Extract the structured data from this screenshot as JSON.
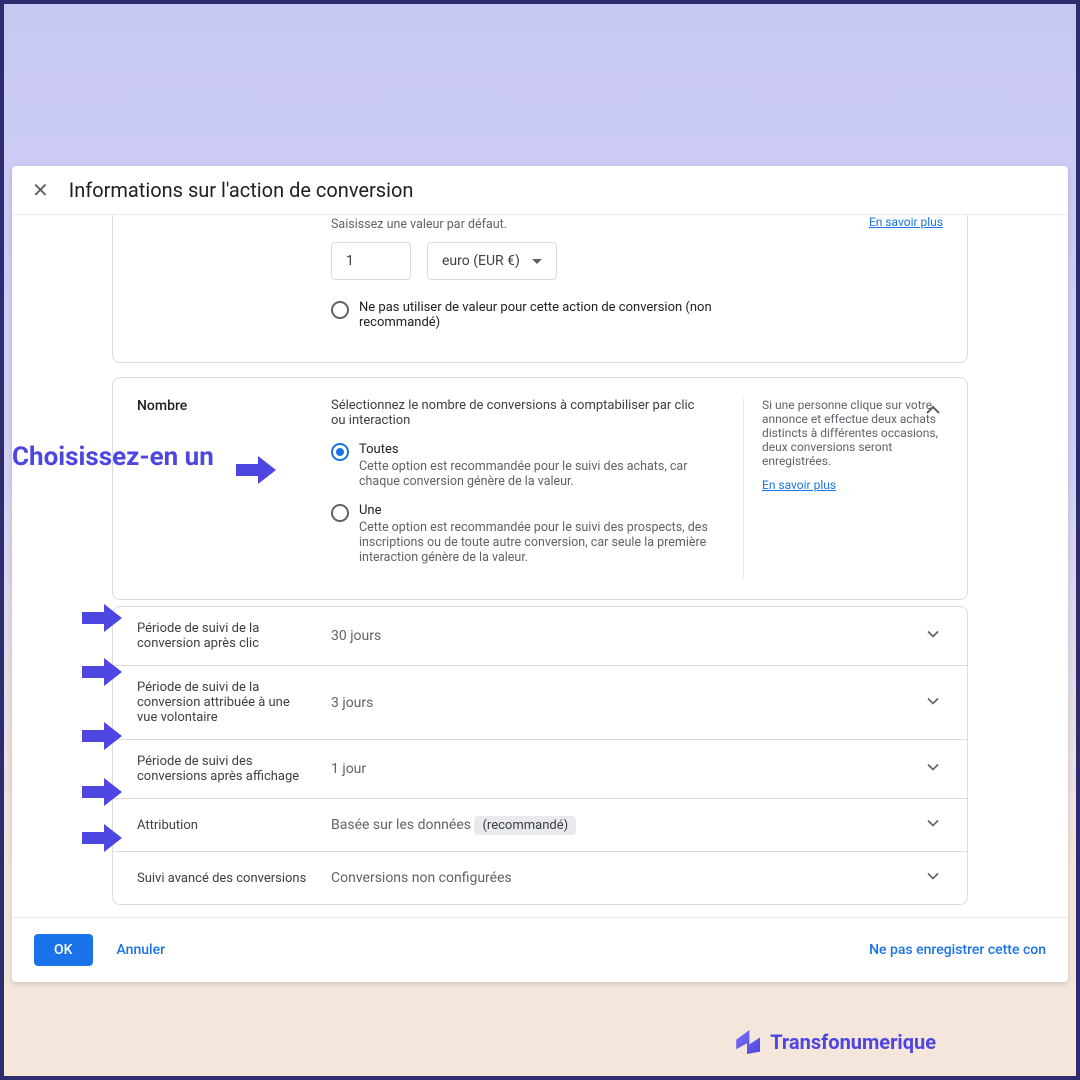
{
  "header": {
    "title": "Informations sur l'action de conversion"
  },
  "value_section": {
    "prompt": "Saisissez une valeur par défaut.",
    "default_value": "1",
    "currency_label": "euro (EUR €)",
    "no_value_label": "Ne pas utiliser de valeur pour cette action de conversion (non recommandé)",
    "learn_more_cut": "En savoir plus"
  },
  "count_section": {
    "title": "Nombre",
    "prompt": "Sélectionnez le nombre de conversions à comptabiliser par clic ou interaction",
    "option_all_label": "Toutes",
    "option_all_desc": "Cette option est recommandée pour le suivi des achats, car chaque conversion génère de la valeur.",
    "option_one_label": "Une",
    "option_one_desc": "Cette option est recommandée pour le suivi des prospects, des inscriptions ou de toute autre conversion, car seule la première interaction génère de la valeur.",
    "help_text": "Si une personne clique sur votre annonce et effectue deux achats distincts à différentes occasions, deux conversions seront enregistrées.",
    "learn_more": "En savoir plus"
  },
  "settings": [
    {
      "label": "Période de suivi de la conversion après clic",
      "value": "30 jours"
    },
    {
      "label": "Période de suivi de la conversion attribuée à une vue volontaire",
      "value": "3 jours"
    },
    {
      "label": "Période de suivi des conversions après affichage",
      "value": "1 jour"
    },
    {
      "label": "Attribution",
      "value": "Basée sur les données",
      "badge": "(recommandé)"
    },
    {
      "label": "Suivi avancé des conversions",
      "value": "Conversions non configurées"
    }
  ],
  "footer": {
    "ok": "OK",
    "cancel": "Annuler",
    "nosave": "Ne pas enregistrer cette con"
  },
  "annotations": {
    "choose_one": "Choisissez-en un"
  },
  "brand": "Transfonumerique"
}
